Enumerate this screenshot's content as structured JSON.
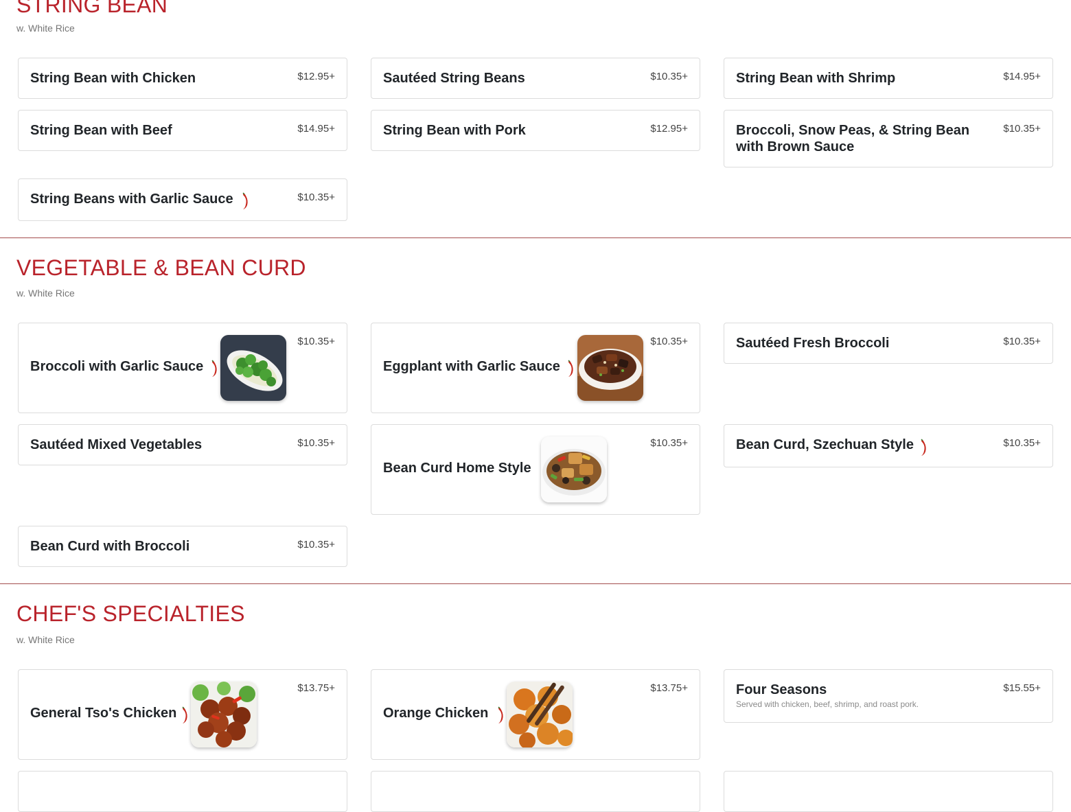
{
  "sections": [
    {
      "title": "STRING BEAN",
      "subtitle": "w. White Rice",
      "items": [
        {
          "name": "String Bean with Chicken",
          "price": "$12.95+"
        },
        {
          "name": "Sautéed String Beans",
          "price": "$10.35+"
        },
        {
          "name": "String Bean with Shrimp",
          "price": "$14.95+"
        },
        {
          "name": "String Bean with Beef",
          "price": "$14.95+"
        },
        {
          "name": "String Bean with Pork",
          "price": "$12.95+"
        },
        {
          "name": "Broccoli, Snow Peas, & String Bean with Brown Sauce",
          "price": "$10.35+"
        },
        {
          "name": "String Beans with Garlic Sauce",
          "price": "$10.35+",
          "spicy": true
        }
      ]
    },
    {
      "title": "VEGETABLE & BEAN CURD",
      "subtitle": "w. White Rice",
      "items": [
        {
          "name": "Broccoli with Garlic Sauce",
          "price": "$10.35+",
          "spicy": true,
          "image": "broccoli-dish-photo"
        },
        {
          "name": "Eggplant with Garlic Sauce",
          "price": "$10.35+",
          "spicy": true,
          "image": "eggplant-dish-photo"
        },
        {
          "name": "Sautéed Fresh Broccoli",
          "price": "$10.35+"
        },
        {
          "name": "Sautéed Mixed Vegetables",
          "price": "$10.35+"
        },
        {
          "name": "Bean Curd Home Style",
          "price": "$10.35+",
          "image": "bean-curd-dish-photo"
        },
        {
          "name": "Bean Curd, Szechuan Style",
          "price": "$10.35+",
          "spicy": true
        },
        {
          "name": "Bean Curd with Broccoli",
          "price": "$10.35+"
        }
      ]
    },
    {
      "title": "CHEF'S SPECIALTIES",
      "subtitle": "w. White Rice",
      "items": [
        {
          "name": "General Tso's Chicken",
          "price": "$13.75+",
          "spicy": true,
          "image": "general-tso-dish-photo"
        },
        {
          "name": "Orange Chicken",
          "price": "$13.75+",
          "spicy": true,
          "image": "orange-chicken-dish-photo"
        },
        {
          "name": "Four Seasons",
          "price": "$15.55+",
          "description": "Served with chicken, beef, shrimp, and roast pork."
        }
      ]
    }
  ],
  "colors": {
    "section_title": "#b9232b",
    "divider": "#a34c4c",
    "card_border": "#dcdcdc",
    "chili": "#c8281e"
  },
  "icons": {
    "spicy": "chili-pepper-icon"
  }
}
